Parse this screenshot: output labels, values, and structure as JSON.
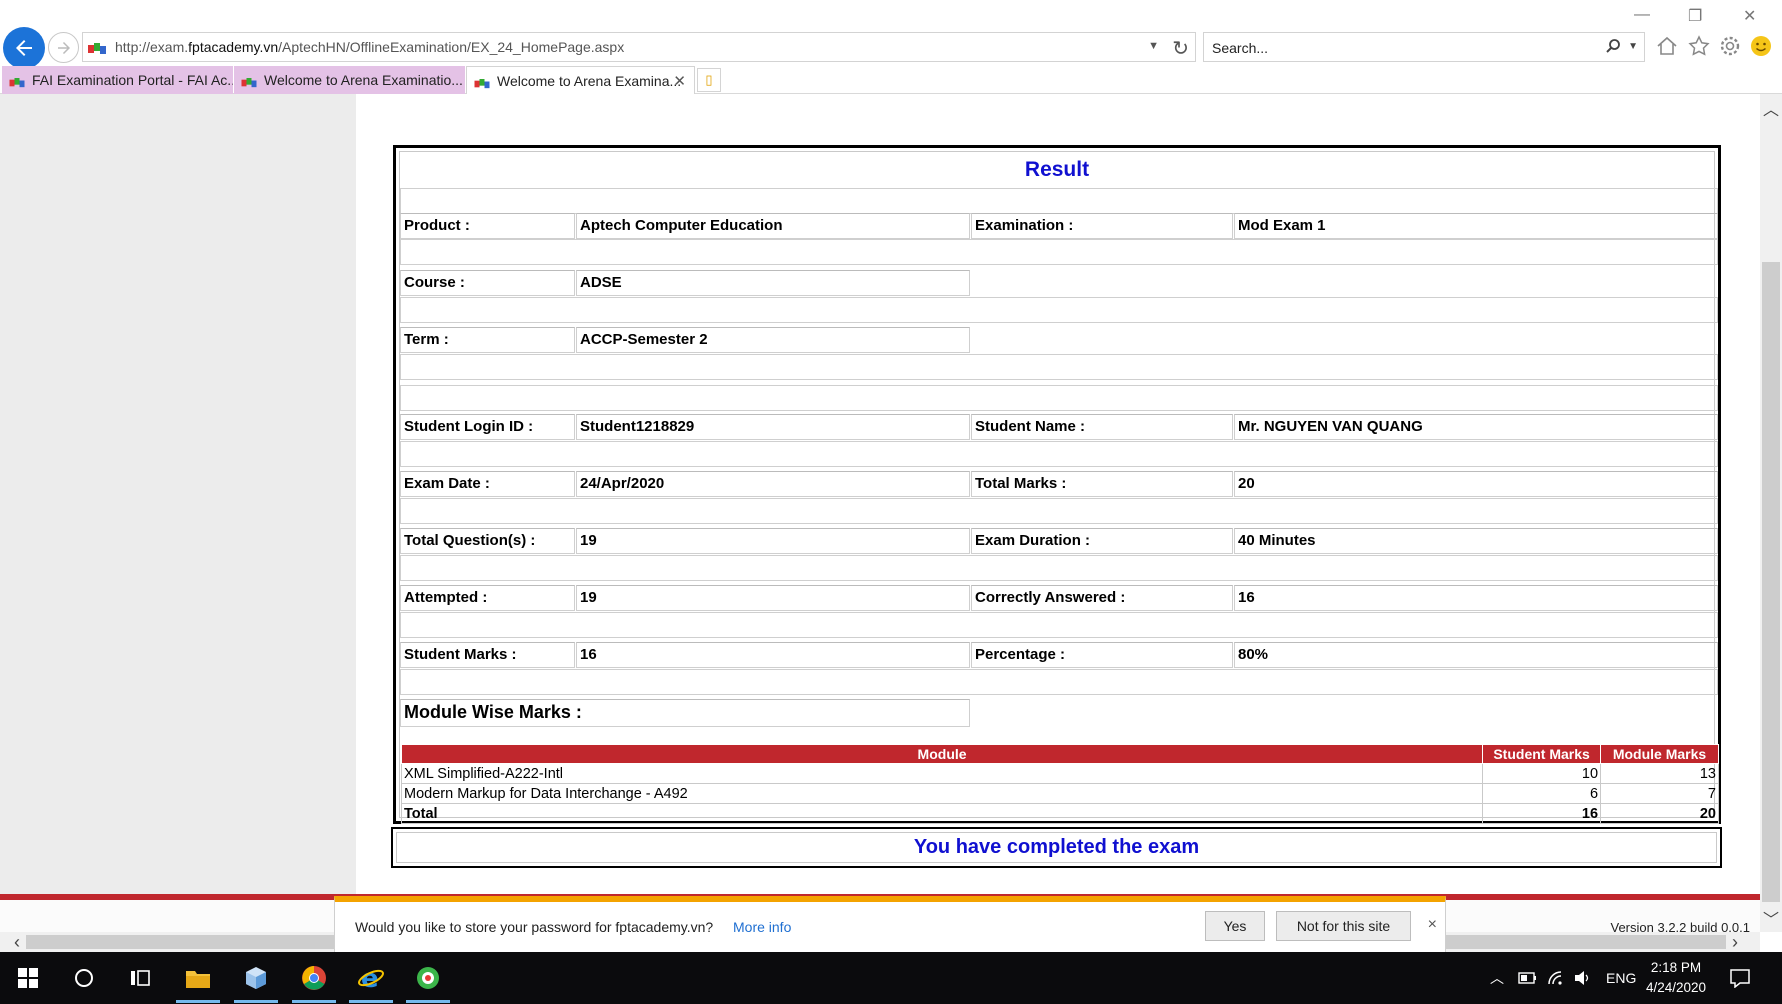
{
  "browser": {
    "url_prefix": "http://exam.",
    "url_host": "fptacademy.vn",
    "url_path": "/AptechHN/OfflineExamination/EX_24_HomePage.aspx",
    "search_placeholder": "Search...",
    "tabs": [
      {
        "label": "FAI Examination Portal - FAI Ac..."
      },
      {
        "label": "Welcome to Arena Examinatio..."
      },
      {
        "label": "Welcome to Arena Examina..."
      }
    ],
    "tab_close": "✕"
  },
  "result": {
    "title": "Result",
    "product_label": "Product :",
    "product_value": "Aptech Computer Education",
    "examination_label": "Examination :",
    "examination_value": "Mod Exam 1",
    "course_label": "Course :",
    "course_value": "ADSE",
    "term_label": "Term :",
    "term_value": "ACCP-Semester 2",
    "login_label": "Student Login ID :",
    "login_value": "Student1218829",
    "name_label": "Student Name :",
    "name_value": "Mr. NGUYEN VAN QUANG",
    "date_label": "Exam Date :",
    "date_value": "24/Apr/2020",
    "total_marks_label": "Total Marks :",
    "total_marks_value": "20",
    "questions_label": "Total Question(s) :",
    "questions_value": "19",
    "duration_label": "Exam Duration :",
    "duration_value": "40 Minutes",
    "attempted_label": "Attempted :",
    "attempted_value": "19",
    "correct_label": "Correctly Answered :",
    "correct_value": "16",
    "student_marks_label": "Student Marks :",
    "student_marks_value": "16",
    "percentage_label": "Percentage :",
    "percentage_value": "80%",
    "module_wise_label": "Module Wise Marks :"
  },
  "modules": {
    "headers": [
      "Module",
      "Student Marks",
      "Module Marks"
    ],
    "rows": [
      {
        "module": "XML Simplified-A222-Intl",
        "student": "10",
        "module_marks": "13"
      },
      {
        "module": "Modern Markup for Data Interchange - A492",
        "student": "6",
        "module_marks": "7"
      }
    ],
    "total": {
      "label": "Total",
      "student": "16",
      "module_marks": "20"
    }
  },
  "completion_message": "You have completed the exam",
  "version": "Version 3.2.2 build 0.0.1",
  "password_bar": {
    "message": "Would you like to store your password for fptacademy.vn?",
    "more_info": "More info",
    "yes": "Yes",
    "not_for_site": "Not for this site",
    "close": "×"
  },
  "taskbar": {
    "language": "ENG",
    "time": "2:18 PM",
    "date": "4/24/2020"
  },
  "colors": {
    "header_red": "#c0272d",
    "title_blue": "#1010d0",
    "tab_purple": "#e4c2e6",
    "ie_blue": "#1c73d8"
  }
}
